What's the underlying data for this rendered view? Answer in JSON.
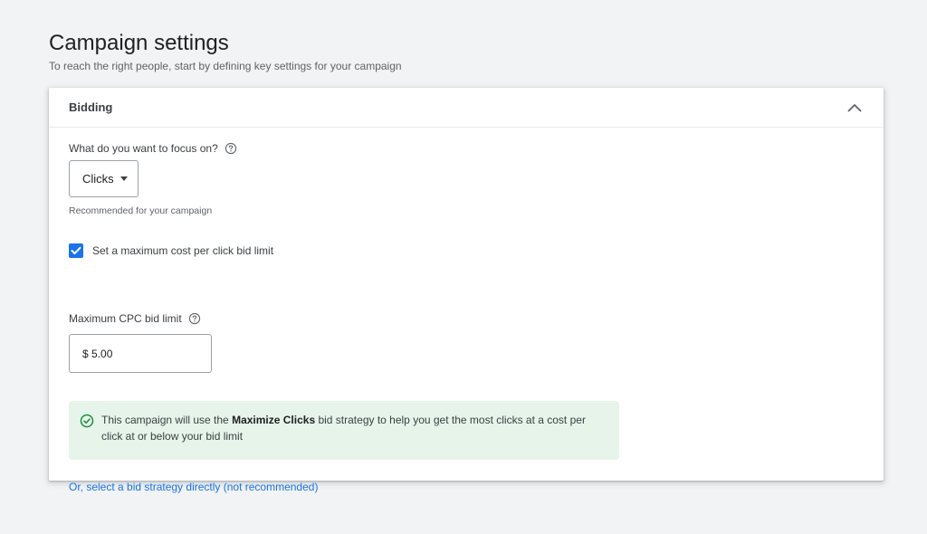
{
  "page": {
    "title": "Campaign settings",
    "subtitle": "To reach the right people, start by defining key settings for your campaign"
  },
  "bidding": {
    "section_title": "Bidding",
    "focus_question": "What do you want to focus on?",
    "focus_selected": "Clicks",
    "focus_hint": "Recommended for your campaign",
    "max_cpc_checkbox_label": "Set a maximum cost per click bid limit",
    "max_cpc_checked": true,
    "max_cpc_field_label": "Maximum CPC bid limit",
    "max_cpc_value": "$ 5.00",
    "info": {
      "prefix": "This campaign will use the ",
      "strategy": "Maximize Clicks",
      "suffix": " bid strategy to help you get the most clicks at a cost per click at or below your bid limit"
    },
    "strategy_link": "Or, select a bid strategy directly (not recommended)"
  },
  "colors": {
    "accent": "#1a73e8",
    "success": "#1e8e3e",
    "info_background": "#e6f4ea",
    "page_background": "#f1f3f4"
  },
  "icons": {
    "collapse": "chevron-up-icon",
    "help": "help-circle-icon",
    "checkbox": "check-icon",
    "info": "check-circle-icon",
    "dropdown": "caret-down-icon"
  }
}
